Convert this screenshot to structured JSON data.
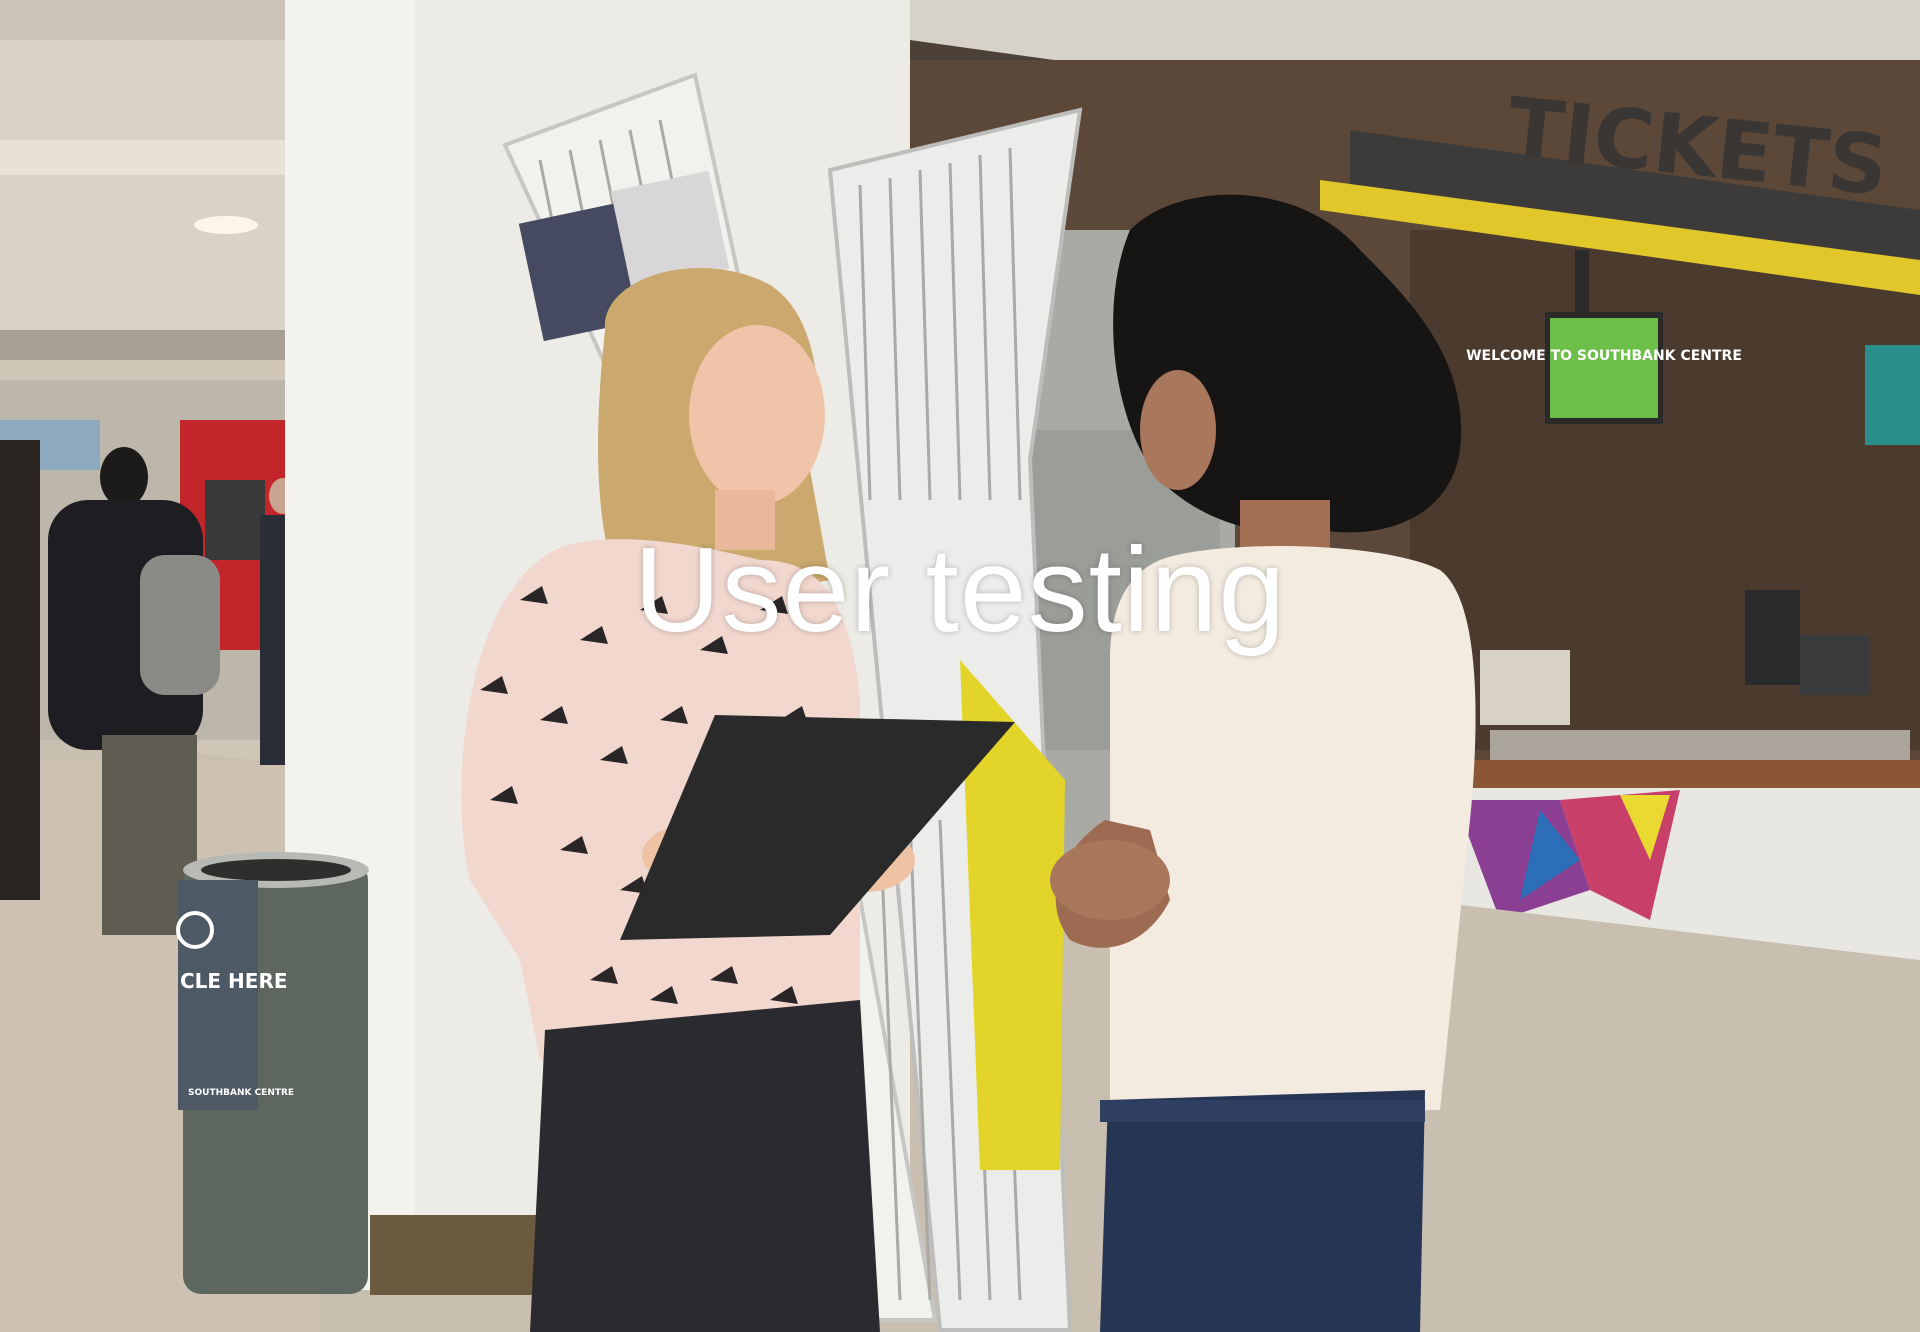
{
  "slide": {
    "title": "User testing"
  },
  "scene": {
    "signs": {
      "tickets": "TICKETS",
      "welcome_screen": "WELCOME TO SOUTHBANK CENTRE",
      "recycle_bin": "CLE HERE",
      "bin_brand": "SOUTHBANK CENTRE"
    }
  },
  "colors": {
    "caption": "#ffffff",
    "pillar": "#ecebe6",
    "floor": "#c9bfb0",
    "wall_wood": "#5a4838",
    "bin": "#5e6660",
    "welcome_screen": "#6cc04a",
    "counter_accent": "#e8d628"
  }
}
